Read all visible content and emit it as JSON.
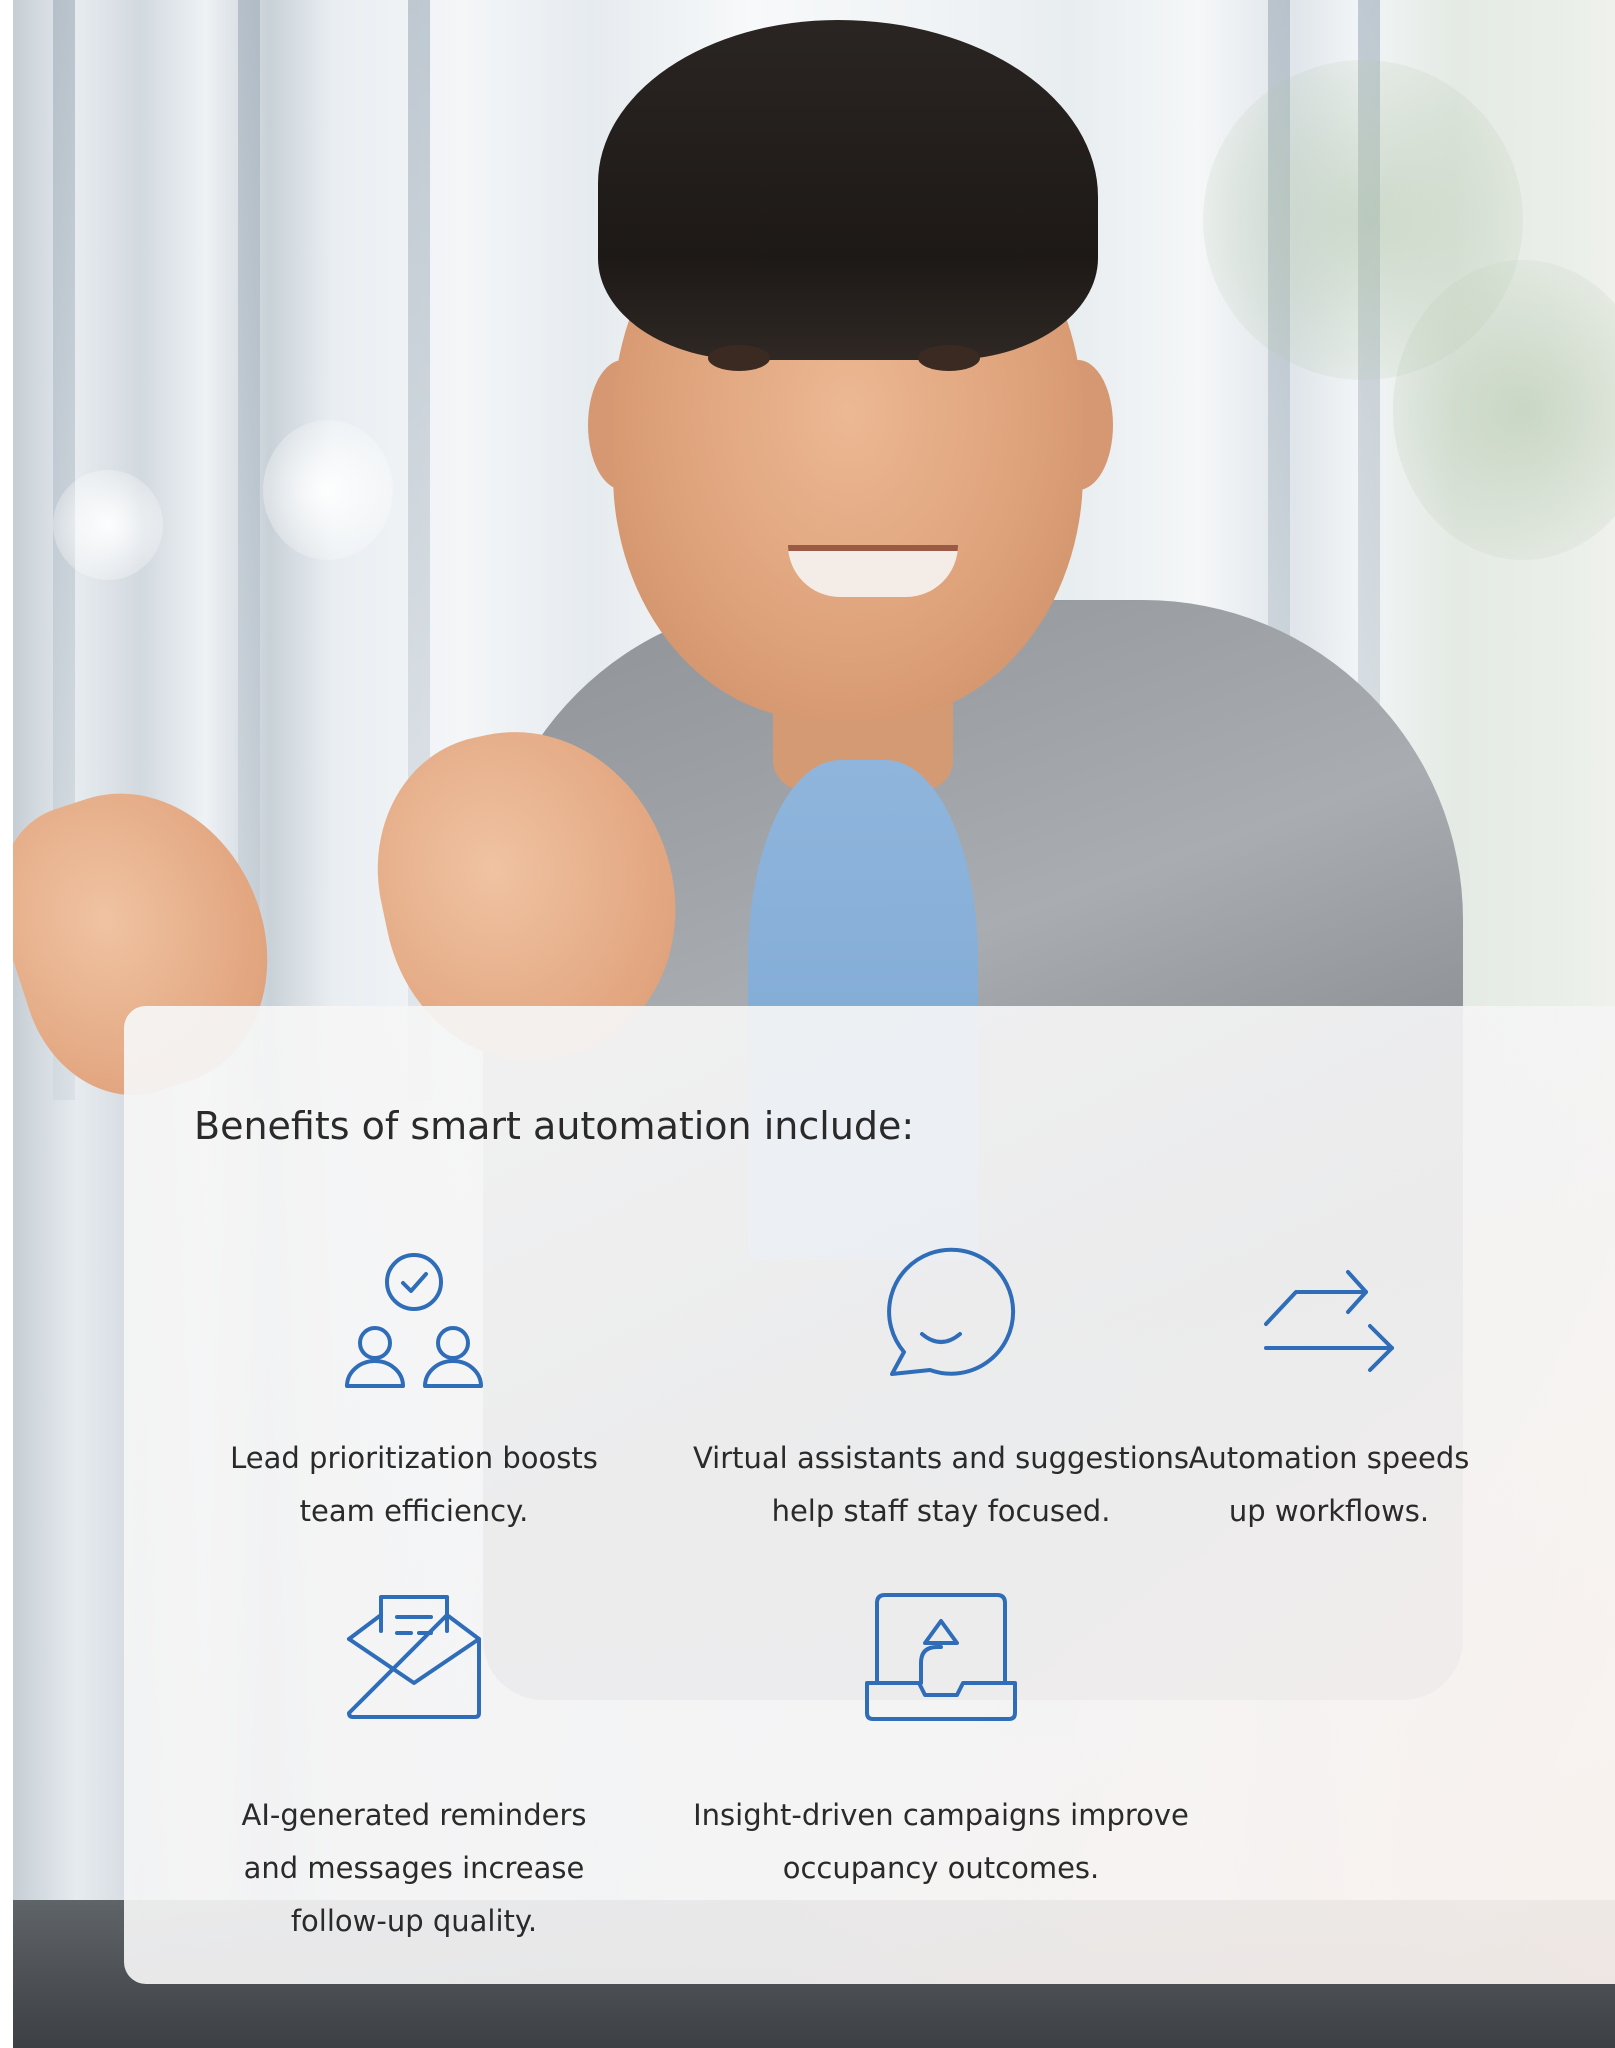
{
  "theme": {
    "icon_color": "#2f6db8",
    "text_color": "#2a2a2a"
  },
  "card": {
    "title": "Benefits of smart automation include:"
  },
  "benefits": [
    {
      "icon": "team-check-icon",
      "lines": [
        "Lead prioritization boosts",
        "team efficiency."
      ]
    },
    {
      "icon": "chat-bubble-smile-icon",
      "lines": [
        "Virtual assistants and suggestions",
        "help staff stay focused."
      ]
    },
    {
      "icon": "workflow-arrows-icon",
      "lines": [
        "Automation speeds",
        "up workflows."
      ]
    },
    {
      "icon": "envelope-message-icon",
      "lines": [
        "AI-generated reminders",
        "and messages increase",
        "follow-up quality."
      ]
    },
    {
      "icon": "upload-tray-icon",
      "lines": [
        "Insight-driven campaigns improve",
        "occupancy outcomes."
      ]
    }
  ]
}
